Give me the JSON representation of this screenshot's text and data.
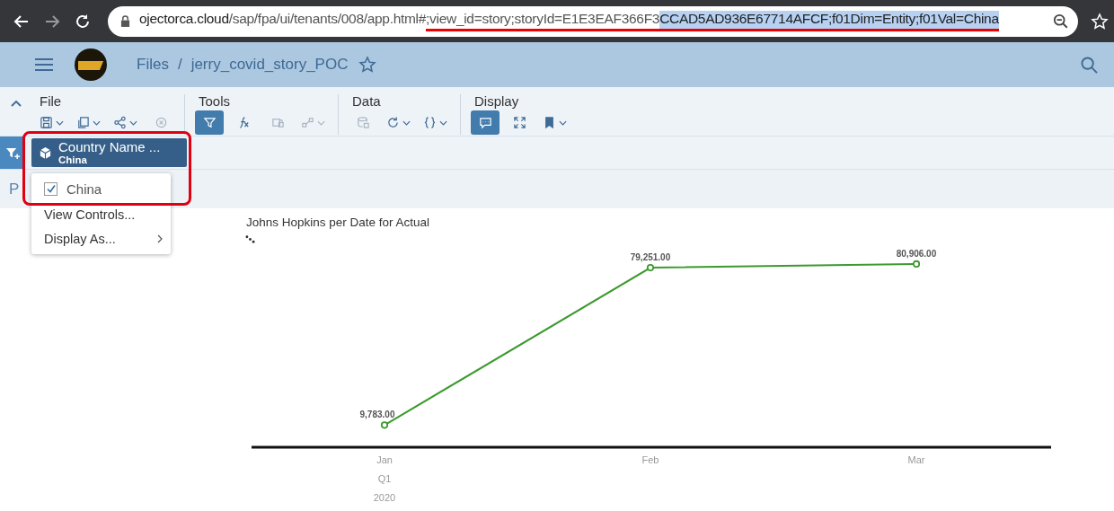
{
  "browser": {
    "url_parts": [
      {
        "text": "ojectorca.cloud",
        "kind": "host",
        "selected": false,
        "underlined": false
      },
      {
        "text": "/sap/fpa/ui/tenants/008/app.html#",
        "kind": "path",
        "selected": false,
        "underlined": false
      },
      {
        "text": ";view_id=story;storyId=E1E3EAF366F3",
        "kind": "path",
        "selected": false,
        "underlined": true
      },
      {
        "text": "CCAD5AD936E67714AFCF;f01Dim=Entity;f01Val=China",
        "kind": "path",
        "selected": true,
        "underlined": true
      }
    ]
  },
  "shell": {
    "breadcrumb": [
      "Files",
      "jerry_covid_story_POC"
    ],
    "separator": "/",
    "favorite": false
  },
  "toolbar": {
    "groups": [
      {
        "label": "File",
        "tools": [
          {
            "kind": "save",
            "selected": false,
            "disabled": false,
            "dropdown": true
          },
          {
            "kind": "copy",
            "selected": false,
            "disabled": false,
            "dropdown": true
          },
          {
            "kind": "share",
            "selected": false,
            "disabled": false,
            "dropdown": true
          },
          {
            "kind": "cancel",
            "selected": false,
            "disabled": true,
            "dropdown": false
          }
        ]
      },
      {
        "label": "Tools",
        "tools": [
          {
            "kind": "filter",
            "selected": true,
            "disabled": false,
            "dropdown": false
          },
          {
            "kind": "formula",
            "selected": false,
            "disabled": false,
            "dropdown": false
          },
          {
            "kind": "lock",
            "selected": false,
            "disabled": true,
            "dropdown": false
          },
          {
            "kind": "link",
            "selected": false,
            "disabled": true,
            "dropdown": true
          }
        ]
      },
      {
        "label": "Data",
        "tools": [
          {
            "kind": "database",
            "selected": false,
            "disabled": true,
            "dropdown": false
          },
          {
            "kind": "refresh",
            "selected": false,
            "disabled": false,
            "dropdown": true
          },
          {
            "kind": "braces",
            "selected": false,
            "disabled": false,
            "dropdown": true
          }
        ]
      },
      {
        "label": "Display",
        "tools": [
          {
            "kind": "comment",
            "selected": true,
            "disabled": false,
            "dropdown": false
          },
          {
            "kind": "fullscreen",
            "selected": false,
            "disabled": false,
            "dropdown": false
          },
          {
            "kind": "bookmark",
            "selected": false,
            "disabled": false,
            "dropdown": true
          }
        ]
      }
    ]
  },
  "filter_bar": {
    "filter": {
      "name": "Country Name ...",
      "value": "China"
    }
  },
  "page_tabs": {
    "partial_tab": "P"
  },
  "filter_menu": {
    "options": [
      {
        "label": "China",
        "checked": true
      }
    ],
    "items": [
      {
        "label": "View Controls...",
        "submenu": false
      },
      {
        "label": "Display As...",
        "submenu": true
      }
    ]
  },
  "chart": {
    "title": "Johns Hopkins per Date for Actual",
    "quarter": "Q1",
    "year": "2020",
    "chart_data": {
      "type": "line",
      "categories": [
        "Jan",
        "Feb",
        "Mar"
      ],
      "series": [
        {
          "color": "#3c9a2e",
          "marker": "circle",
          "values": [
            9783,
            79251,
            80906
          ],
          "value_labels": [
            "9,783.00",
            "79,251.00",
            "80,906.00"
          ]
        }
      ]
    }
  }
}
